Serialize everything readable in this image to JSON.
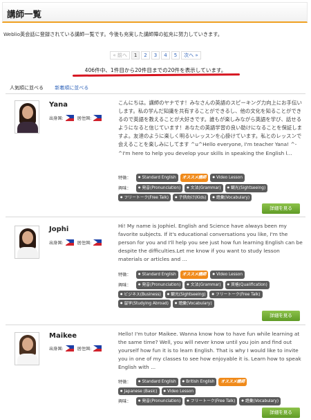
{
  "header": {
    "title": "講師一覧"
  },
  "intro": "Weblio英会話に登録されている講師一覧です。今後も充実した講師陣の拡充に努力していきます。",
  "pagination": {
    "prev": "« 前へ",
    "pages": [
      "1",
      "2",
      "3",
      "4",
      "5"
    ],
    "current": "1",
    "next": "次へ »"
  },
  "results_summary": "406件中、1件目から20件目までの20件を表示しています。",
  "sort": {
    "popular": "人気順に並べる",
    "newest": "新着順に並べる"
  },
  "labels": {
    "origin": "出身国:",
    "residence": "居住国:",
    "features": "特徴：",
    "interests": "興味：",
    "details_button": "詳細を見る"
  },
  "colors": {
    "accent_orange": "#f0a020",
    "recommend_tag": "#f08a1a",
    "button_green": "#6aa830",
    "underline_red": "#d6141f",
    "link_blue": "#3366bb"
  },
  "teachers": [
    {
      "name": "Yana",
      "description": "こんにちは。講師のヤナです！みなさんの英語のスピーキング力向上にお手伝いします。私の学んだ知識を共有することができるし、他の文化を知ることができるので英語を教えることが大好きです。誰もが楽しみながら英語を学び、話せるようになると信じています！あなたの英語学習の良い助けになることを保証しますよ。友達のように楽しく明るいレッスンを心掛けています。私とのレッスンで会えることを楽しみにしてます ^u^Hello everyone, I'm teacher Yana! ^-^I'm here to help you develop your skills in speaking the English l...",
      "features": [
        "Standard English",
        "オススメ講師",
        "Video Lesson"
      ],
      "interests": [
        "発音(Pronunciation)",
        "文法(Grammar)",
        "観光(Sightseeing)",
        "フリートーク(Free Talk)",
        "子供向け(Kids)",
        "語彙(Vocabulary)"
      ]
    },
    {
      "name": "Jophi",
      "description": "Hi! My name is Jophiel. English and Science have always been my favorite subjects. If it's educational conversations you like, I'm the person for you and I'll help you see just how fun learning English can be despite the difficulties.Let me know if you want to study lesson materials or articles and ...",
      "features": [
        "Standard English",
        "オススメ講師",
        "Video Lesson"
      ],
      "interests": [
        "発音(Pronunciation)",
        "文法(Grammar)",
        "資格(Qualification)",
        "ビジネス(Business)",
        "観光(Sightseeing)",
        "フリートーク(Free Talk)",
        "留学(Studying Abroad)",
        "語彙(Vocabulary)"
      ]
    },
    {
      "name": "Maikee",
      "description": "Hello! I'm tutor Maikee. Wanna know how to have fun while learning at the same time? Well, you will never know until you join and find out yourself how fun it is to learn English. That is why I would like to invite you in one of my classes to see how enjoyable it is. Learn how to speak English with ...",
      "features": [
        "Standard English",
        "British English",
        "オススメ講師",
        "Japanese (Basic)",
        "Video Lesson"
      ],
      "interests": [
        "発音(Pronunciation)",
        "フリートーク(Free Talk)",
        "語彙(Vocabulary)"
      ]
    }
  ]
}
